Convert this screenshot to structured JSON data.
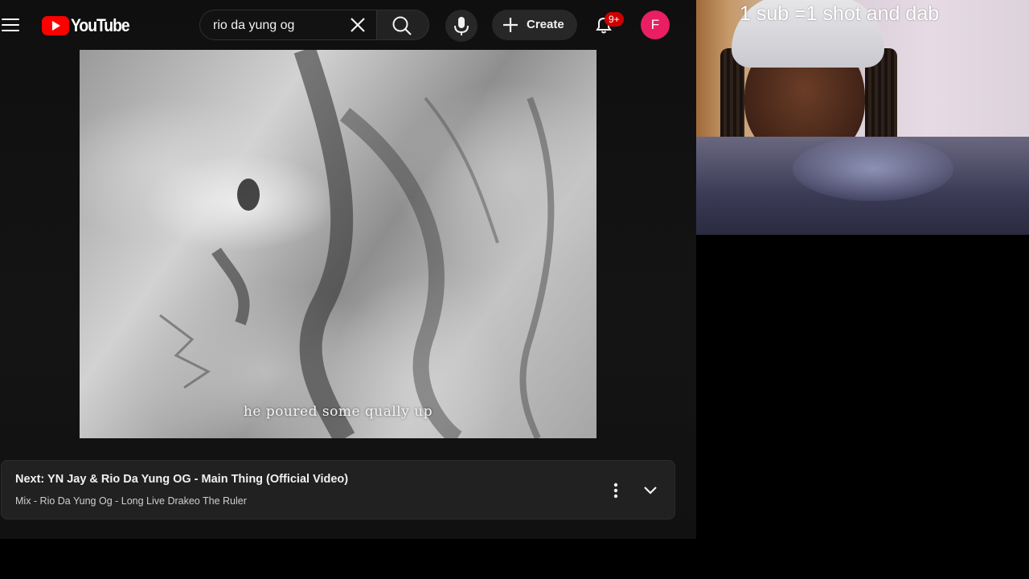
{
  "header": {
    "logo_text": "YouTube",
    "search": {
      "value": "rio da yung og"
    },
    "create_label": "Create",
    "notification_badge": "9+",
    "avatar_initial": "F"
  },
  "player": {
    "subtitle": "he poured some qually up"
  },
  "up_next": {
    "title": "Next: YN Jay & Rio Da Yung OG - Main Thing (Official Video)",
    "subtitle": "Mix - Rio Da Yung Og - Long Live Drakeo The Ruler"
  },
  "stream_overlay": {
    "text": "1 sub =1 shot and dab"
  },
  "colors": {
    "youtube_red": "#ff0000",
    "avatar": "#e91e63",
    "badge": "#cc0000"
  },
  "icons": [
    "menu-icon",
    "youtube-logo-icon",
    "close-icon",
    "search-icon",
    "mic-icon",
    "plus-icon",
    "bell-icon",
    "more-vert-icon",
    "chevron-down-icon"
  ]
}
